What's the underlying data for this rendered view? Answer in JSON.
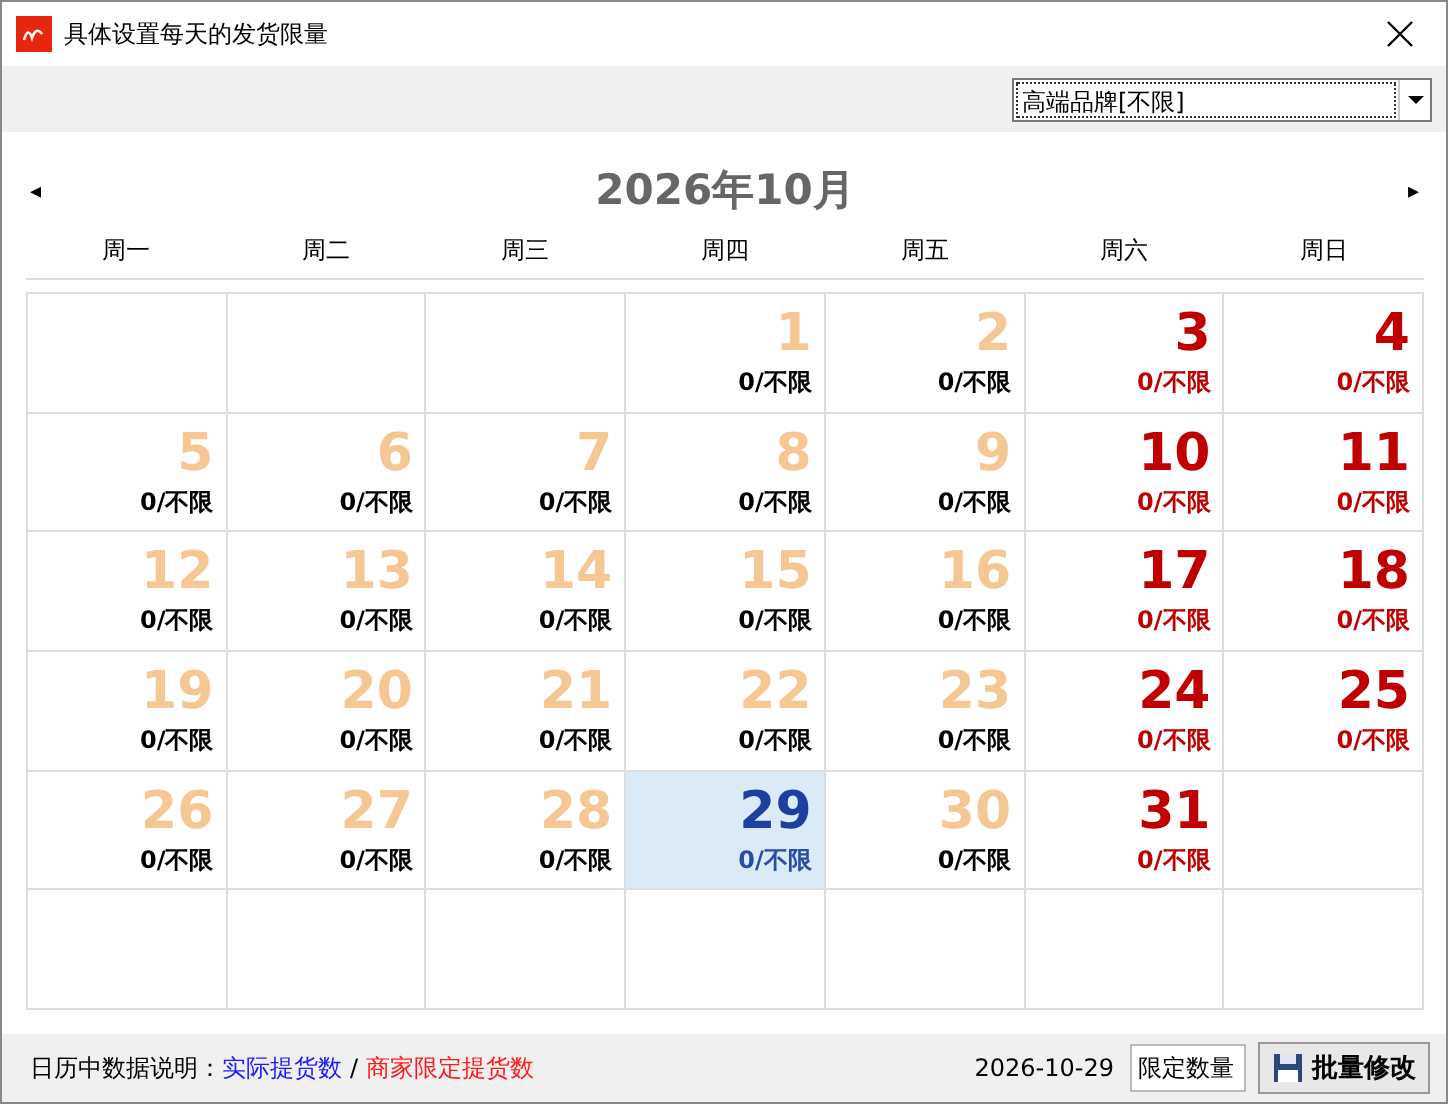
{
  "window": {
    "title": "具体设置每天的发货限量"
  },
  "brand_select": {
    "value": "高端品牌[不限]"
  },
  "calendar": {
    "month_title": "2026年10月",
    "prev": "◂",
    "next": "▸",
    "weekdays": [
      "周一",
      "周二",
      "周三",
      "周四",
      "周五",
      "周六",
      "周日"
    ],
    "weeks": [
      [
        {
          "kind": "blank"
        },
        {
          "kind": "blank"
        },
        {
          "kind": "blank"
        },
        {
          "day": "1",
          "quota": "0/不限",
          "weekend": false,
          "selected": false
        },
        {
          "day": "2",
          "quota": "0/不限",
          "weekend": false,
          "selected": false
        },
        {
          "day": "3",
          "quota": "0/不限",
          "weekend": true,
          "selected": false
        },
        {
          "day": "4",
          "quota": "0/不限",
          "weekend": true,
          "selected": false
        }
      ],
      [
        {
          "day": "5",
          "quota": "0/不限",
          "weekend": false,
          "selected": false
        },
        {
          "day": "6",
          "quota": "0/不限",
          "weekend": false,
          "selected": false
        },
        {
          "day": "7",
          "quota": "0/不限",
          "weekend": false,
          "selected": false
        },
        {
          "day": "8",
          "quota": "0/不限",
          "weekend": false,
          "selected": false
        },
        {
          "day": "9",
          "quota": "0/不限",
          "weekend": false,
          "selected": false
        },
        {
          "day": "10",
          "quota": "0/不限",
          "weekend": true,
          "selected": false
        },
        {
          "day": "11",
          "quota": "0/不限",
          "weekend": true,
          "selected": false
        }
      ],
      [
        {
          "day": "12",
          "quota": "0/不限",
          "weekend": false,
          "selected": false
        },
        {
          "day": "13",
          "quota": "0/不限",
          "weekend": false,
          "selected": false
        },
        {
          "day": "14",
          "quota": "0/不限",
          "weekend": false,
          "selected": false
        },
        {
          "day": "15",
          "quota": "0/不限",
          "weekend": false,
          "selected": false
        },
        {
          "day": "16",
          "quota": "0/不限",
          "weekend": false,
          "selected": false
        },
        {
          "day": "17",
          "quota": "0/不限",
          "weekend": true,
          "selected": false
        },
        {
          "day": "18",
          "quota": "0/不限",
          "weekend": true,
          "selected": false
        }
      ],
      [
        {
          "day": "19",
          "quota": "0/不限",
          "weekend": false,
          "selected": false
        },
        {
          "day": "20",
          "quota": "0/不限",
          "weekend": false,
          "selected": false
        },
        {
          "day": "21",
          "quota": "0/不限",
          "weekend": false,
          "selected": false
        },
        {
          "day": "22",
          "quota": "0/不限",
          "weekend": false,
          "selected": false
        },
        {
          "day": "23",
          "quota": "0/不限",
          "weekend": false,
          "selected": false
        },
        {
          "day": "24",
          "quota": "0/不限",
          "weekend": true,
          "selected": false
        },
        {
          "day": "25",
          "quota": "0/不限",
          "weekend": true,
          "selected": false
        }
      ],
      [
        {
          "day": "26",
          "quota": "0/不限",
          "weekend": false,
          "selected": false
        },
        {
          "day": "27",
          "quota": "0/不限",
          "weekend": false,
          "selected": false
        },
        {
          "day": "28",
          "quota": "0/不限",
          "weekend": false,
          "selected": false
        },
        {
          "day": "29",
          "quota": "0/不限",
          "weekend": false,
          "selected": true
        },
        {
          "day": "30",
          "quota": "0/不限",
          "weekend": false,
          "selected": false
        },
        {
          "day": "31",
          "quota": "0/不限",
          "weekend": true,
          "selected": false
        },
        {
          "kind": "blank"
        }
      ],
      [
        {
          "kind": "blank"
        },
        {
          "kind": "blank"
        },
        {
          "kind": "blank"
        },
        {
          "kind": "blank"
        },
        {
          "kind": "blank"
        },
        {
          "kind": "blank"
        },
        {
          "kind": "blank"
        }
      ]
    ]
  },
  "footer": {
    "legend_label": "日历中数据说明：",
    "legend_actual": "实际提货数",
    "legend_sep": "/",
    "legend_limit": "商家限定提货数",
    "date": "2026-10-29",
    "limit_field": "限定数量",
    "batch_button": "批量修改"
  }
}
